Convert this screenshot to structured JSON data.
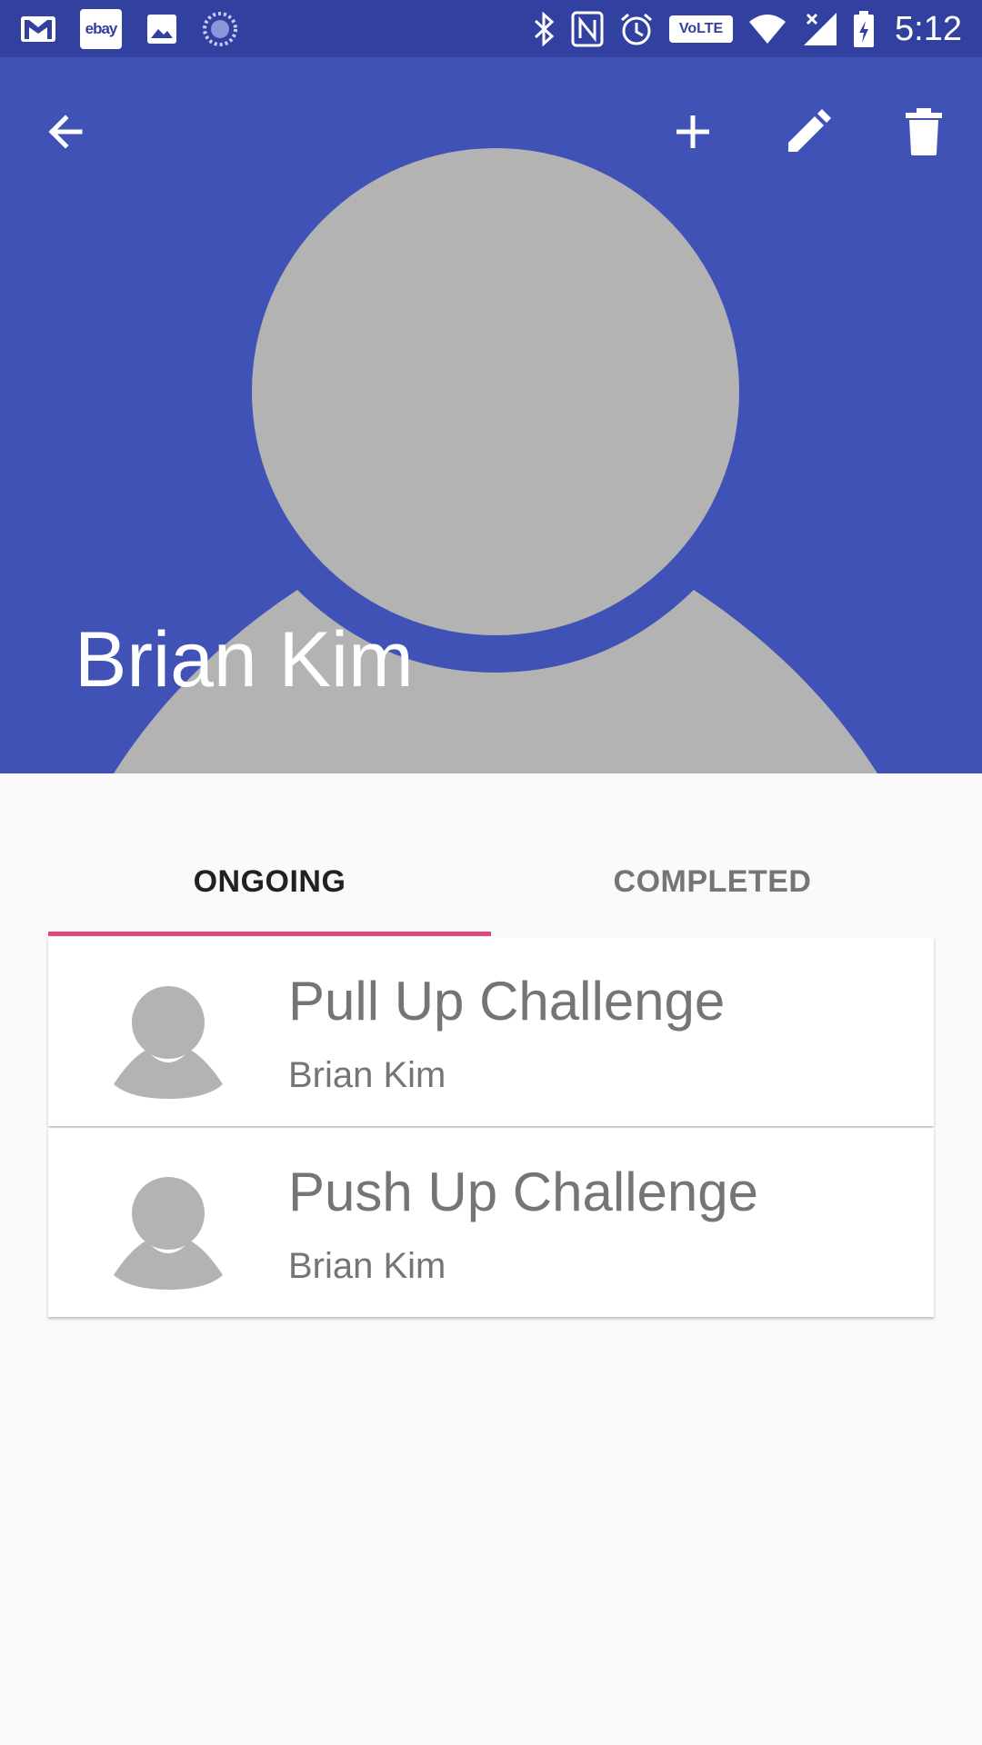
{
  "status_bar": {
    "time": "5:12",
    "left_icons": [
      "gmail-icon",
      "ebay-icon",
      "gallery-icon",
      "loading-icon"
    ],
    "ebay_label": "ebay",
    "volte_label": "VoLTE",
    "right_icons": [
      "bluetooth-icon",
      "nfc-icon",
      "alarm-icon",
      "volte-icon",
      "wifi-icon",
      "signal-icon",
      "battery-charging-icon"
    ]
  },
  "toolbar": {
    "back_icon": "arrow-back-icon",
    "add_icon": "plus-icon",
    "edit_icon": "pencil-icon",
    "delete_icon": "trash-icon"
  },
  "profile": {
    "name": "Brian Kim"
  },
  "tabs": [
    {
      "label": "ONGOING",
      "active": true
    },
    {
      "label": "COMPLETED",
      "active": false
    }
  ],
  "challenges": [
    {
      "title": "Pull Up Challenge",
      "owner": "Brian Kim"
    },
    {
      "title": "Push Up Challenge",
      "owner": "Brian Kim"
    }
  ],
  "colors": {
    "status_bar": "#3240a0",
    "header": "#4152b7",
    "avatar_gray": "#b3b3b3",
    "tab_indicator": "#e0487a",
    "background": "#fafafa"
  }
}
